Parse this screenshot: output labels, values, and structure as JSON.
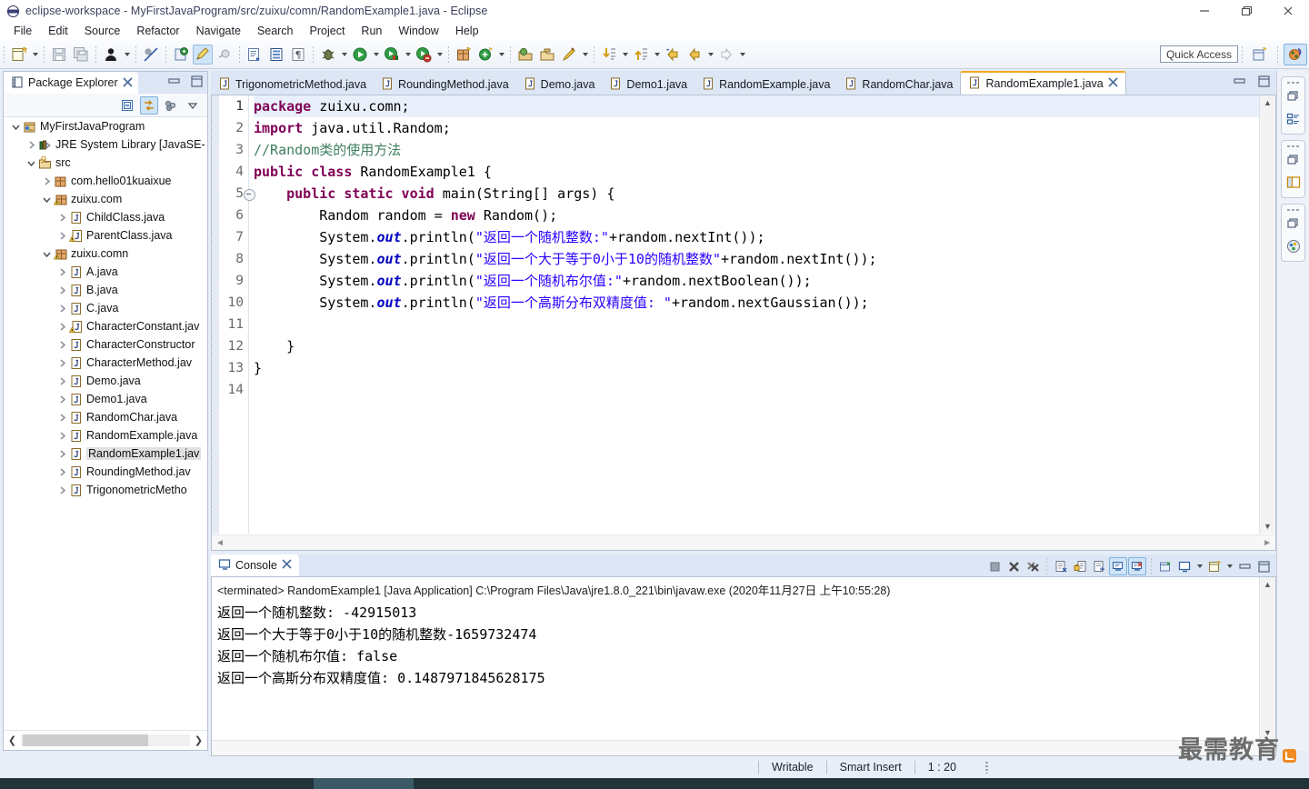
{
  "window": {
    "title": "eclipse-workspace - MyFirstJavaProgram/src/zuixu/comn/RandomExample1.java - Eclipse",
    "icon": "eclipse-icon",
    "controls": {
      "minimize": "minimize-icon",
      "maximize": "maximize-icon",
      "close": "close-icon"
    }
  },
  "menubar": {
    "items": [
      "File",
      "Edit",
      "Source",
      "Refactor",
      "Navigate",
      "Search",
      "Project",
      "Run",
      "Window",
      "Help"
    ]
  },
  "toolbar": {
    "quick_access": "Quick Access",
    "buttons": [
      "new-icon",
      "save-icon",
      "save-all-icon",
      "debug-person-icon",
      "skip-breakpoints-icon",
      "new-java-class-icon",
      "annotate-icon",
      "toggle-icon",
      "external-tools-icon",
      "open-type-icon",
      "toggle-mark-occurrences-icon",
      "show-whitespace-icon",
      "debug-icon",
      "run-icon",
      "coverage-icon",
      "profile-icon",
      "new-package-icon",
      "new-class-wizard-icon",
      "open-task-icon",
      "search-icon",
      "open-folder-icon",
      "pencil-icon",
      "next-annotation-icon",
      "previous-annotation-icon",
      "back-icon",
      "forward-nav-icon",
      "forward-icon"
    ],
    "perspective_buttons": [
      "open-perspective-icon",
      "java-perspective-icon"
    ]
  },
  "package_explorer": {
    "tab_label": "Package Explorer",
    "tab_close": "close-icon",
    "view_buttons": [
      "minimize-icon",
      "maximize-icon"
    ],
    "tool_buttons": [
      "collapse-all-icon",
      "link-with-editor-icon",
      "view-menu-icon",
      "chevron-down-icon"
    ],
    "tree": [
      {
        "label": "MyFirstJavaProgram",
        "depth": 0,
        "twisty": "expanded",
        "icon": "java-project-icon",
        "selected": false
      },
      {
        "label": "JRE System Library [JavaSE-",
        "depth": 1,
        "twisty": "collapsed",
        "icon": "library-icon",
        "selected": false
      },
      {
        "label": "src",
        "depth": 1,
        "twisty": "expanded",
        "icon": "source-folder-icon",
        "selected": false
      },
      {
        "label": "com.hello01kuaixue",
        "depth": 2,
        "twisty": "collapsed",
        "icon": "package-icon",
        "selected": false
      },
      {
        "label": "zuixu.com",
        "depth": 2,
        "twisty": "expanded",
        "icon": "package-warn-icon",
        "selected": false
      },
      {
        "label": "ChildClass.java",
        "depth": 3,
        "twisty": "collapsed",
        "icon": "java-file-icon",
        "selected": false
      },
      {
        "label": "ParentClass.java",
        "depth": 3,
        "twisty": "collapsed",
        "icon": "java-file-warn-icon",
        "selected": false
      },
      {
        "label": "zuixu.comn",
        "depth": 2,
        "twisty": "expanded",
        "icon": "package-warn-icon",
        "selected": false
      },
      {
        "label": "A.java",
        "depth": 3,
        "twisty": "collapsed",
        "icon": "java-file-icon",
        "selected": false
      },
      {
        "label": "B.java",
        "depth": 3,
        "twisty": "collapsed",
        "icon": "java-file-icon",
        "selected": false
      },
      {
        "label": "C.java",
        "depth": 3,
        "twisty": "collapsed",
        "icon": "java-file-icon",
        "selected": false
      },
      {
        "label": "CharacterConstant.jav",
        "depth": 3,
        "twisty": "collapsed",
        "icon": "java-file-warn-icon",
        "selected": false
      },
      {
        "label": "CharacterConstructor",
        "depth": 3,
        "twisty": "collapsed",
        "icon": "java-file-icon",
        "selected": false
      },
      {
        "label": "CharacterMethod.jav",
        "depth": 3,
        "twisty": "collapsed",
        "icon": "java-file-icon",
        "selected": false
      },
      {
        "label": "Demo.java",
        "depth": 3,
        "twisty": "collapsed",
        "icon": "java-file-icon",
        "selected": false
      },
      {
        "label": "Demo1.java",
        "depth": 3,
        "twisty": "collapsed",
        "icon": "java-file-icon",
        "selected": false
      },
      {
        "label": "RandomChar.java",
        "depth": 3,
        "twisty": "collapsed",
        "icon": "java-file-icon",
        "selected": false
      },
      {
        "label": "RandomExample.java",
        "depth": 3,
        "twisty": "collapsed",
        "icon": "java-file-icon",
        "selected": false
      },
      {
        "label": "RandomExample1.jav",
        "depth": 3,
        "twisty": "collapsed",
        "icon": "java-file-icon",
        "selected": true
      },
      {
        "label": "RoundingMethod.jav",
        "depth": 3,
        "twisty": "collapsed",
        "icon": "java-file-icon",
        "selected": false
      },
      {
        "label": "TrigonometricMetho",
        "depth": 3,
        "twisty": "collapsed",
        "icon": "java-file-icon",
        "selected": false
      }
    ]
  },
  "editor": {
    "tabs": [
      {
        "label": "TrigonometricMethod.java",
        "active": false
      },
      {
        "label": "RoundingMethod.java",
        "active": false
      },
      {
        "label": "Demo.java",
        "active": false
      },
      {
        "label": "Demo1.java",
        "active": false
      },
      {
        "label": "RandomExample.java",
        "active": false
      },
      {
        "label": "RandomChar.java",
        "active": false
      },
      {
        "label": "RandomExample1.java",
        "active": true
      }
    ],
    "active_tab_close": "close-icon",
    "view_buttons": [
      "minimize-icon",
      "maximize-icon"
    ],
    "lines": [
      {
        "n": "1",
        "fold": false,
        "highlight": true,
        "tokens": [
          {
            "t": "kw",
            "v": "package"
          },
          {
            "t": "tx",
            "v": " zuixu.comn;"
          }
        ]
      },
      {
        "n": "2",
        "fold": false,
        "highlight": false,
        "tokens": [
          {
            "t": "kw",
            "v": "import"
          },
          {
            "t": "tx",
            "v": " java.util.Random;"
          }
        ]
      },
      {
        "n": "3",
        "fold": false,
        "highlight": false,
        "tokens": [
          {
            "t": "cm",
            "v": "//Random类的使用方法"
          }
        ]
      },
      {
        "n": "4",
        "fold": false,
        "highlight": false,
        "tokens": [
          {
            "t": "kw",
            "v": "public class"
          },
          {
            "t": "tx",
            "v": " RandomExample1 {"
          }
        ]
      },
      {
        "n": "5",
        "fold": true,
        "highlight": false,
        "tokens": [
          {
            "t": "tx",
            "v": "    "
          },
          {
            "t": "kw",
            "v": "public static void"
          },
          {
            "t": "tx",
            "v": " main(String[] args) {"
          }
        ]
      },
      {
        "n": "6",
        "fold": false,
        "highlight": false,
        "tokens": [
          {
            "t": "tx",
            "v": "        Random random = "
          },
          {
            "t": "kw",
            "v": "new"
          },
          {
            "t": "tx",
            "v": " Random();"
          }
        ]
      },
      {
        "n": "7",
        "fold": false,
        "highlight": false,
        "tokens": [
          {
            "t": "tx",
            "v": "        System."
          },
          {
            "t": "fld",
            "v": "out"
          },
          {
            "t": "tx",
            "v": ".println("
          },
          {
            "t": "st",
            "v": "\"返回一个随机整数:\""
          },
          {
            "t": "tx",
            "v": "+random.nextInt());"
          }
        ]
      },
      {
        "n": "8",
        "fold": false,
        "highlight": false,
        "tokens": [
          {
            "t": "tx",
            "v": "        System."
          },
          {
            "t": "fld",
            "v": "out"
          },
          {
            "t": "tx",
            "v": ".println("
          },
          {
            "t": "st",
            "v": "\"返回一个大于等于0小于10的随机整数\""
          },
          {
            "t": "tx",
            "v": "+random.nextInt());"
          }
        ]
      },
      {
        "n": "9",
        "fold": false,
        "highlight": false,
        "tokens": [
          {
            "t": "tx",
            "v": "        System."
          },
          {
            "t": "fld",
            "v": "out"
          },
          {
            "t": "tx",
            "v": ".println("
          },
          {
            "t": "st",
            "v": "\"返回一个随机布尔值:\""
          },
          {
            "t": "tx",
            "v": "+random.nextBoolean());"
          }
        ]
      },
      {
        "n": "10",
        "fold": false,
        "highlight": false,
        "tokens": [
          {
            "t": "tx",
            "v": "        System."
          },
          {
            "t": "fld",
            "v": "out"
          },
          {
            "t": "tx",
            "v": ".println("
          },
          {
            "t": "st",
            "v": "\"返回一个高斯分布双精度值: \""
          },
          {
            "t": "tx",
            "v": "+random.nextGaussian());"
          }
        ]
      },
      {
        "n": "11",
        "fold": false,
        "highlight": false,
        "tokens": []
      },
      {
        "n": "12",
        "fold": false,
        "highlight": false,
        "tokens": [
          {
            "t": "tx",
            "v": "    }"
          }
        ]
      },
      {
        "n": "13",
        "fold": false,
        "highlight": false,
        "tokens": [
          {
            "t": "tx",
            "v": "}"
          }
        ]
      },
      {
        "n": "14",
        "fold": false,
        "highlight": false,
        "tokens": []
      }
    ]
  },
  "console": {
    "tab_label": "Console",
    "tab_close": "close-icon",
    "tools": [
      "terminate-icon",
      "remove-launch-icon",
      "remove-all-terminated-icon",
      "clear-console-icon",
      "scroll-lock-icon",
      "word-wrap-icon",
      "show-console-on-output-icon",
      "show-console-on-error-icon",
      "pin-console-icon",
      "display-selected-console-icon",
      "chevron-down-icon",
      "open-console-icon",
      "chevron-down-icon",
      "minimize-icon",
      "maximize-icon"
    ],
    "terminated_line": "<terminated> RandomExample1 [Java Application] C:\\Program Files\\Java\\jre1.8.0_221\\bin\\javaw.exe (2020年11月27日 上午10:55:28)",
    "output": [
      "返回一个随机整数: -42915013",
      "返回一个大于等于0小于10的随机整数-1659732474",
      "返回一个随机布尔值: false",
      "返回一个高斯分布双精度值: 0.1487971845628175"
    ]
  },
  "right_strip": {
    "groups": [
      [
        "restore-icon",
        "outline-view-icon"
      ],
      [
        "restore-icon",
        "package-explorer-view-icon"
      ],
      [
        "restore-icon",
        "console-view-icon"
      ]
    ]
  },
  "status_bar": {
    "writable": "Writable",
    "insert_mode": "Smart Insert",
    "position": "1 : 20"
  },
  "watermark": {
    "text": "最需教育",
    "badge": "rss-icon"
  }
}
